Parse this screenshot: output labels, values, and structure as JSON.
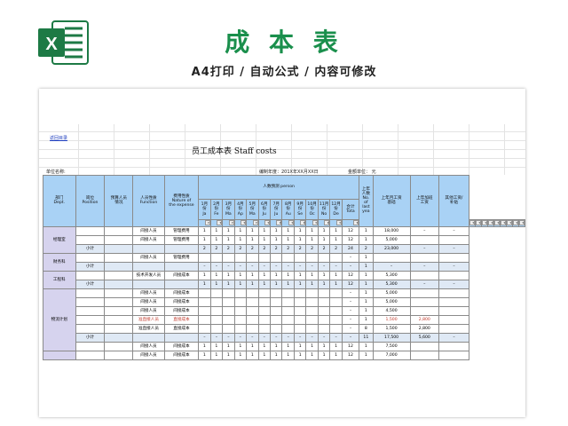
{
  "hero": {
    "title": "成 本 表",
    "subtitle": "A4打印 / 自动公式 / 内容可修改",
    "logo_letter": "X",
    "accent": "#1a8f4c",
    "logo_color": "#1d7a45"
  },
  "sheet": {
    "back_link": "返回目录",
    "title": "员工成本表   Staff costs",
    "unit_name_label": "单位名称:",
    "prepared_label": "编制年度：201X年XX月XX日",
    "currency_label": "金额单位：   元",
    "headers": {
      "dept": "部门\nDept.",
      "position": "岗位\nPosition",
      "budget": "预算人员\n情况",
      "function": "人员性质\nFunction",
      "nature": "费用性质\nNature of\nthe expense",
      "people": "人数预测    person",
      "months": [
        "1月\n份\nJa",
        "2月\n份\nFe",
        "3月\n份\nMa",
        "4月\n份\nAp",
        "5月\n份\nMa",
        "6月\n份\nJu",
        "7月\n份\nJu",
        "8月\n份\nAu",
        "9月\n份\nSe",
        "10月\n份\nOc",
        "11月\n份\nNo",
        "12月\n份\nDe"
      ],
      "total": "合计\nTota",
      "last_year": "上年\n人数\nNo.\nof\nlast\nyea",
      "base": "上年月工资\n基础",
      "overtime": "上年加班\n工资",
      "other": "其他工资/\n补贴"
    },
    "rows": [
      {
        "dept": "",
        "pos": "",
        "budget": "",
        "func": "间接人员",
        "nature": "管理费用",
        "months": [
          "1",
          "1",
          "1",
          "1",
          "1",
          "1",
          "1",
          "1",
          "1",
          "1",
          "1",
          "1"
        ],
        "total": "12",
        "last": "1",
        "base": "18,000",
        "ot": "–",
        "other": "–",
        "type": "row"
      },
      {
        "dept": "经理室",
        "pos": "",
        "budget": "",
        "func": "间接人员",
        "nature": "管理费用",
        "months": [
          "1",
          "1",
          "1",
          "1",
          "1",
          "1",
          "1",
          "1",
          "1",
          "1",
          "1",
          "1"
        ],
        "total": "12",
        "last": "1",
        "base": "5,000",
        "ot": "",
        "other": "",
        "type": "row"
      },
      {
        "dept": "",
        "pos": "小计",
        "budget": "",
        "func": "",
        "nature": "",
        "months": [
          "2",
          "2",
          "2",
          "2",
          "2",
          "2",
          "2",
          "2",
          "2",
          "2",
          "2",
          "2"
        ],
        "total": "24",
        "last": "2",
        "base": "23,000",
        "ot": "–",
        "other": "–",
        "type": "sub"
      },
      {
        "dept": "财务科",
        "pos": "",
        "budget": "",
        "func": "间接人员",
        "nature": "管理费用",
        "months": [
          "",
          "",
          "",
          "",
          "",
          "",
          "",
          "",
          "",
          "",
          "",
          ""
        ],
        "total": "–",
        "last": "1",
        "base": "",
        "ot": "",
        "other": "",
        "type": "row"
      },
      {
        "dept": "",
        "pos": "小计",
        "budget": "",
        "func": "",
        "nature": "",
        "months": [
          "–",
          "–",
          "–",
          "–",
          "–",
          "–",
          "–",
          "–",
          "–",
          "–",
          "–",
          "–"
        ],
        "total": "–",
        "last": "1",
        "base": "–",
        "ot": "–",
        "other": "–",
        "type": "sub"
      },
      {
        "dept": "工程科",
        "pos": "",
        "budget": "",
        "func": "技术开发人员",
        "nature": "间接成本",
        "months": [
          "1",
          "1",
          "1",
          "1",
          "1",
          "1",
          "1",
          "1",
          "1",
          "1",
          "1",
          "1"
        ],
        "total": "12",
        "last": "1",
        "base": "5,300",
        "ot": "",
        "other": "",
        "type": "row"
      },
      {
        "dept": "",
        "pos": "小计",
        "budget": "",
        "func": "",
        "nature": "",
        "months": [
          "1",
          "1",
          "1",
          "1",
          "1",
          "1",
          "1",
          "1",
          "1",
          "1",
          "1",
          "1"
        ],
        "total": "12",
        "last": "1",
        "base": "5,300",
        "ot": "–",
        "other": "–",
        "type": "sub"
      },
      {
        "dept": "",
        "pos": "",
        "budget": "",
        "func": "间接人员",
        "nature": "间接成本",
        "months": [
          "",
          "",
          "",
          "",
          "",
          "",
          "",
          "",
          "",
          "",
          "",
          ""
        ],
        "total": "–",
        "last": "1",
        "base": "5,000",
        "ot": "",
        "other": "",
        "type": "row"
      },
      {
        "dept": "",
        "pos": "",
        "budget": "",
        "func": "间接人员",
        "nature": "间接成本",
        "months": [
          "",
          "",
          "",
          "",
          "",
          "",
          "",
          "",
          "",
          "",
          "",
          ""
        ],
        "total": "–",
        "last": "1",
        "base": "5,000",
        "ot": "",
        "other": "",
        "type": "row"
      },
      {
        "dept": "物流计划",
        "pos": "",
        "budget": "",
        "func": "间接人员",
        "nature": "间接成本",
        "months": [
          "",
          "",
          "",
          "",
          "",
          "",
          "",
          "",
          "",
          "",
          "",
          ""
        ],
        "total": "–",
        "last": "1",
        "base": "4,500",
        "ot": "",
        "other": "",
        "type": "row"
      },
      {
        "dept": "",
        "pos": "",
        "budget": "",
        "func": "准直接人员",
        "nature": "直接成本",
        "months": [
          "",
          "",
          "",
          "",
          "",
          "",
          "",
          "",
          "",
          "",
          "",
          ""
        ],
        "total": "–",
        "last": "1",
        "base": "1,500",
        "ot": "2,800",
        "other": "",
        "type": "row",
        "red": true
      },
      {
        "dept": "",
        "pos": "",
        "budget": "",
        "func": "准直接人员",
        "nature": "直接成本",
        "months": [
          "",
          "",
          "",
          "",
          "",
          "",
          "",
          "",
          "",
          "",
          "",
          ""
        ],
        "total": "–",
        "last": "8",
        "base": "1,500",
        "ot": "2,800",
        "other": "",
        "type": "row"
      },
      {
        "dept": "",
        "pos": "小计",
        "budget": "",
        "func": "",
        "nature": "",
        "months": [
          "–",
          "–",
          "–",
          "–",
          "–",
          "–",
          "–",
          "–",
          "–",
          "–",
          "–",
          "–"
        ],
        "total": "–",
        "last": "11",
        "base": "17,500",
        "ot": "5,600",
        "other": "–",
        "type": "sub"
      },
      {
        "dept": "",
        "pos": "",
        "budget": "",
        "func": "间接人员",
        "nature": "间接成本",
        "months": [
          "1",
          "1",
          "1",
          "1",
          "1",
          "1",
          "1",
          "1",
          "1",
          "1",
          "1",
          "1"
        ],
        "total": "12",
        "last": "1",
        "base": "7,500",
        "ot": "",
        "other": "",
        "type": "row"
      },
      {
        "dept": "",
        "pos": "",
        "budget": "",
        "func": "间接人员",
        "nature": "间接成本",
        "months": [
          "1",
          "1",
          "1",
          "1",
          "1",
          "1",
          "1",
          "1",
          "1",
          "1",
          "1",
          "1"
        ],
        "total": "12",
        "last": "1",
        "base": "7,000",
        "ot": "",
        "other": "",
        "type": "row"
      }
    ]
  }
}
